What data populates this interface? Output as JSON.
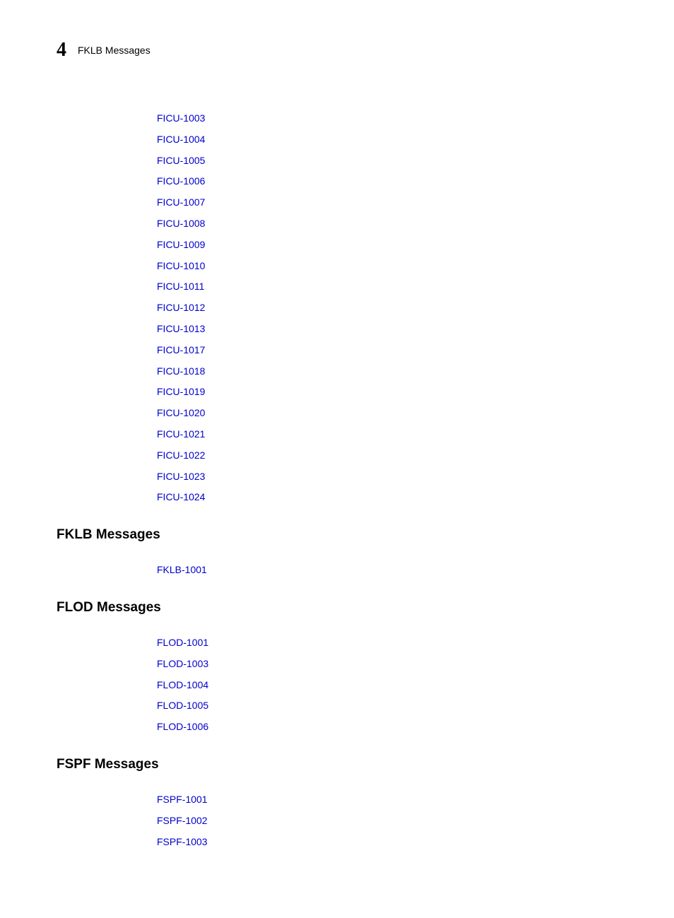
{
  "header": {
    "chapter": "4",
    "title": "FKLB Messages"
  },
  "sections": [
    {
      "heading": null,
      "links": [
        "FICU-1003",
        "FICU-1004",
        "FICU-1005",
        "FICU-1006",
        "FICU-1007",
        "FICU-1008",
        "FICU-1009",
        "FICU-1010",
        "FICU-1011",
        "FICU-1012",
        "FICU-1013",
        "FICU-1017",
        "FICU-1018",
        "FICU-1019",
        "FICU-1020",
        "FICU-1021",
        "FICU-1022",
        "FICU-1023",
        "FICU-1024"
      ]
    },
    {
      "heading": "FKLB Messages",
      "links": [
        "FKLB-1001"
      ]
    },
    {
      "heading": "FLOD Messages",
      "links": [
        "FLOD-1001",
        "FLOD-1003",
        "FLOD-1004",
        "FLOD-1005",
        "FLOD-1006"
      ]
    },
    {
      "heading": "FSPF Messages",
      "links": [
        "FSPF-1001",
        "FSPF-1002",
        "FSPF-1003"
      ]
    }
  ]
}
